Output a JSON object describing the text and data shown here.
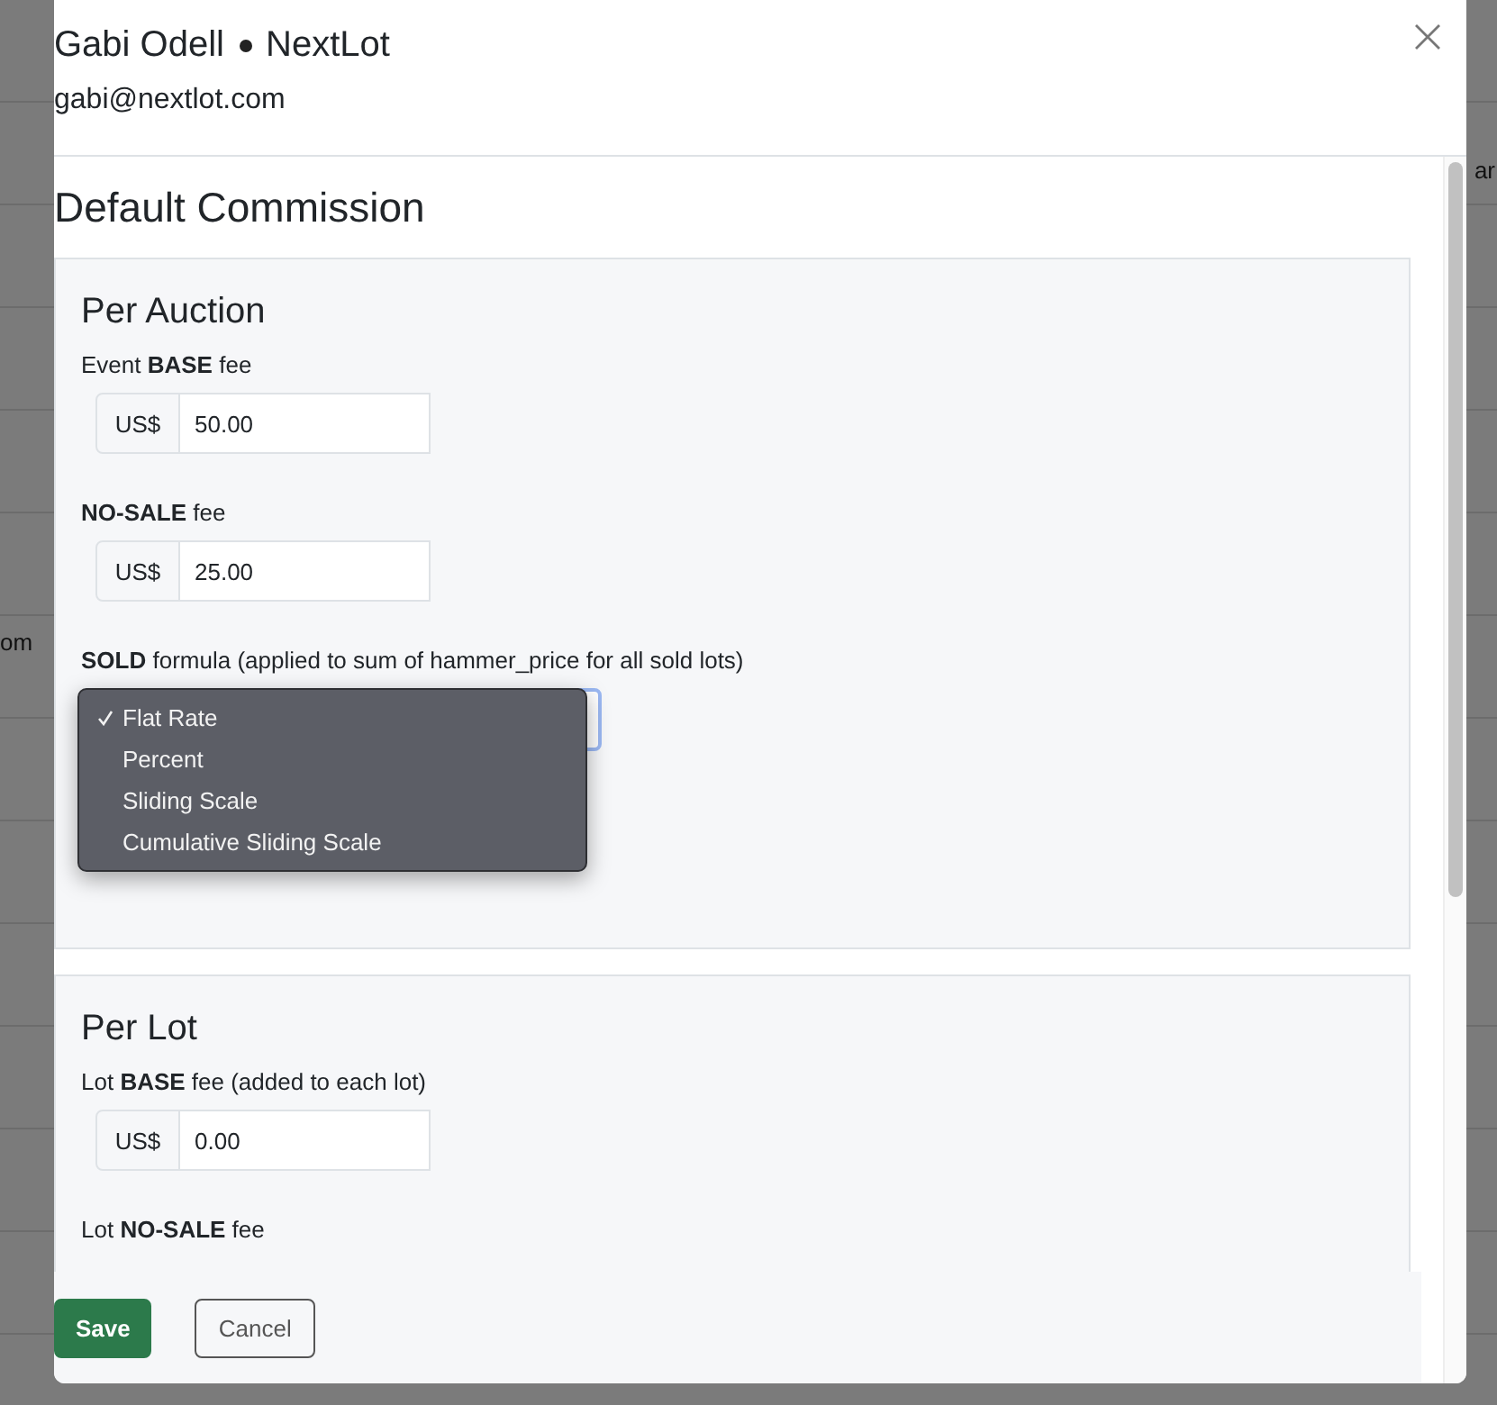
{
  "background_fragments": [
    "om",
    "ar"
  ],
  "modal": {
    "title_name": "Gabi Odell",
    "title_org": "NextLot",
    "email": "gabi@nextlot.com"
  },
  "heading": "Default Commission",
  "sections": [
    {
      "title": "Per Auction",
      "fields": [
        {
          "kind": "money",
          "label": "Event **BASE** fee",
          "prefix": "US$",
          "value": "50.00"
        },
        {
          "kind": "money",
          "label": "**NO-SALE** fee",
          "prefix": "US$",
          "value": "25.00"
        },
        {
          "kind": "select",
          "label": "**SOLD** formula (applied to sum of hammer_price for all sold lots)",
          "options": [
            {
              "label": "Flat Rate",
              "selected": true
            },
            {
              "label": "Percent",
              "selected": false
            },
            {
              "label": "Sliding Scale",
              "selected": false
            },
            {
              "label": "Cumulative Sliding Scale",
              "selected": false
            }
          ]
        }
      ]
    },
    {
      "title": "Per Lot",
      "fields": [
        {
          "kind": "money",
          "label": "Lot **BASE** fee (added to each lot)",
          "prefix": "US$",
          "value": "0.00"
        },
        {
          "kind": "label",
          "label": "Lot **NO-SALE** fee"
        }
      ]
    }
  ],
  "buttons": [
    {
      "label": "Save",
      "kind": "primary"
    },
    {
      "label": "Cancel",
      "kind": "secondary"
    }
  ]
}
